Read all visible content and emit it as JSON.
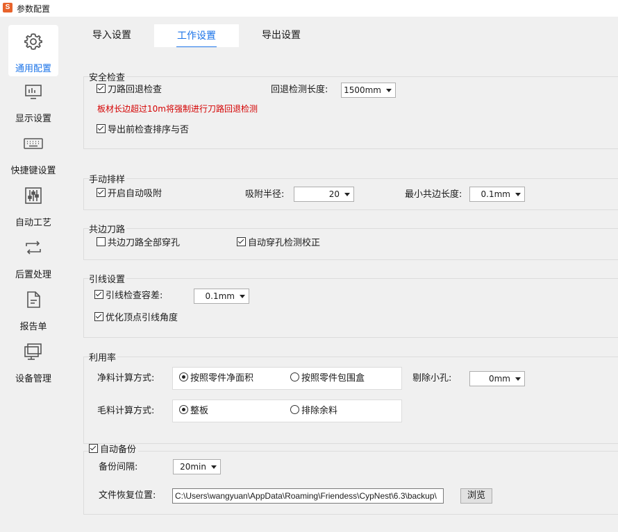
{
  "window": {
    "title": "参数配置",
    "logo_letter": "S"
  },
  "sidebar": {
    "items": [
      {
        "label": "通用配置",
        "icon": "gear-icon"
      },
      {
        "label": "显示设置",
        "icon": "monitor-chart-icon"
      },
      {
        "label": "快捷键设置",
        "icon": "keyboard-icon"
      },
      {
        "label": "自动工艺",
        "icon": "sliders-icon"
      },
      {
        "label": "后置处理",
        "icon": "loop-arrows-icon"
      },
      {
        "label": "报告单",
        "icon": "document-icon"
      },
      {
        "label": "设备管理",
        "icon": "desktop-icon"
      }
    ]
  },
  "tabs": [
    {
      "label": "导入设置"
    },
    {
      "label": "工作设置"
    },
    {
      "label": "导出设置"
    }
  ],
  "safety": {
    "title": "安全检查",
    "backoff_check": "刀路回退检查",
    "backoff_len_label": "回退检测长度:",
    "backoff_len_value": "1500mm",
    "warning": "板材长边超过10m将强制进行刀路回退检测",
    "export_check": "导出前检查排序与否"
  },
  "manual": {
    "title": "手动排样",
    "auto_snap": "开启自动吸附",
    "snap_radius_label": "吸附半径:",
    "snap_radius_value": "20",
    "min_common_label": "最小共边长度:",
    "min_common_value": "0.1mm"
  },
  "common_edge": {
    "title": "共边刀路",
    "all_pierce": "共边刀路全部穿孔",
    "auto_pierce_check": "自动穿孔检测校正"
  },
  "leadin": {
    "title": "引线设置",
    "tolerance_label": "引线检查容差:",
    "tolerance_value": "0.1mm",
    "optimize_vertex": "优化顶点引线角度"
  },
  "utilization": {
    "title": "利用率",
    "net_label": "净料计算方式:",
    "net_opt1": "按照零件净面积",
    "net_opt2": "按照零件包围盒",
    "remove_holes_label": "剔除小孔:",
    "remove_holes_value": "0mm",
    "gross_label": "毛料计算方式:",
    "gross_opt1": "整板",
    "gross_opt2": "排除余料"
  },
  "backup": {
    "title": "自动备份",
    "interval_label": "备份间隔:",
    "interval_value": "20min",
    "restore_label": "文件恢复位置:",
    "restore_path": "C:\\Users\\wangyuan\\AppData\\Roaming\\Friendess\\CypNest\\6.3\\backup\\",
    "browse": "浏览"
  }
}
